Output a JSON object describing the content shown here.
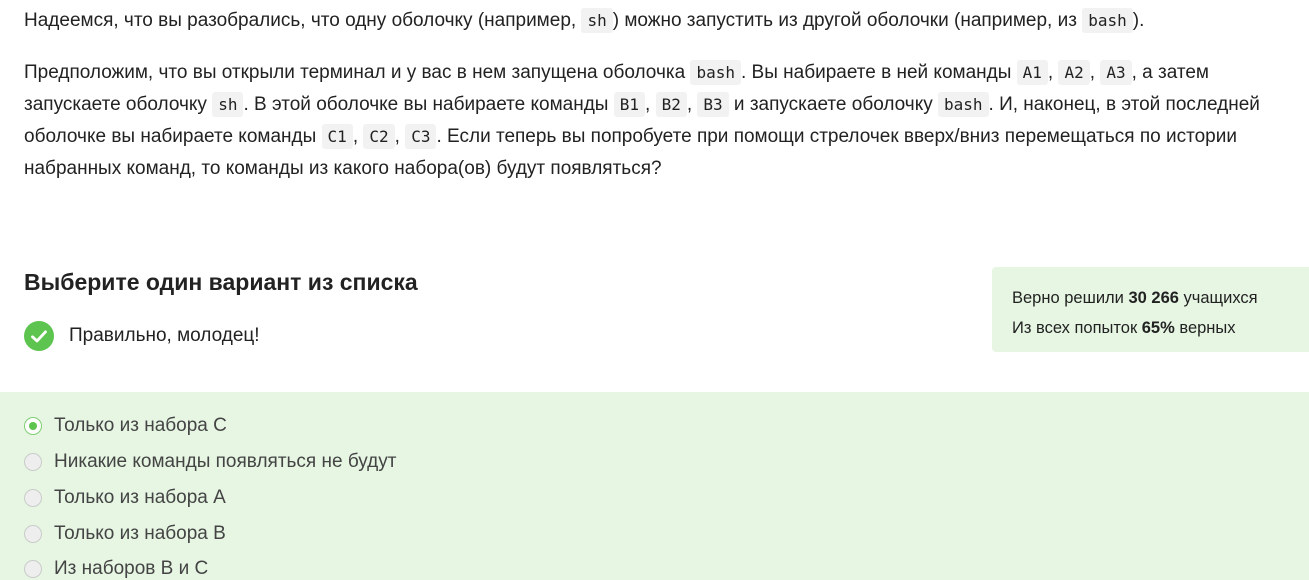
{
  "intro": {
    "t1": "Надеемся, что вы разобрались, что одну оболочку (например, ",
    "c1": "sh",
    "t2": ") можно запустить из другой оболочки (например, из ",
    "c2": "bash",
    "t3": ")."
  },
  "question": {
    "s1": "Предположим, что вы открыли терминал и у вас в нем запущена оболочка ",
    "bash1": "bash",
    "s2": ". Вы набираете в ней команды ",
    "a1": "A1",
    "a2": "A2",
    "a3": "A3",
    "s3": ", а затем запускаете оболочку ",
    "sh": "sh",
    "s4": ". В этой оболочке вы набираете команды ",
    "b1": "B1",
    "b2": "B2",
    "b3": "B3",
    "s5": " и запускаете оболочку ",
    "bash2": "bash",
    "s6": ". И, наконец, в этой последней оболочке вы набираете команды ",
    "c1": "C1",
    "c2": "C2",
    "c3": "C3",
    "s7": ". Если теперь вы попробуете при помощи стрелочек вверх/вниз перемещаться по истории набранных команд, то команды из какого набора(ов) будут появляться?",
    "sep": ", "
  },
  "choose_title": "Выберите один вариант из списка",
  "result_text": "Правильно, молодец!",
  "stats": {
    "line1_prefix": "Верно решили ",
    "solved_count": "30 266",
    "line1_suffix": " учащихся",
    "line2_prefix": "Из всех попыток ",
    "percent": "65%",
    "line2_suffix": " верных"
  },
  "options": [
    {
      "label": "Только из набора C",
      "selected": true
    },
    {
      "label": "Никакие команды появляться не будут",
      "selected": false
    },
    {
      "label": "Только из набора A",
      "selected": false
    },
    {
      "label": "Только из набора B",
      "selected": false
    },
    {
      "label": "Из наборов B и C",
      "selected": false
    }
  ],
  "colors": {
    "accent_green": "#5cc44f",
    "panel_green": "#e6f6e3",
    "code_bg": "#f2f2f2"
  },
  "icons": {
    "result": "check-icon"
  }
}
